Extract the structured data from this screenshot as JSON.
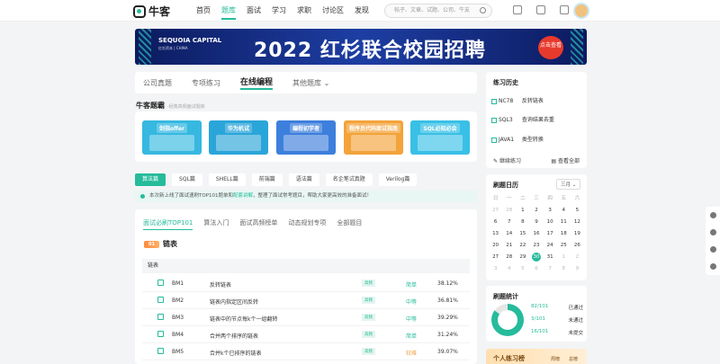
{
  "header": {
    "logo": "牛客",
    "nav": [
      "首页",
      "题库",
      "面试",
      "学习",
      "求职",
      "讨论区",
      "发现"
    ],
    "active_nav": 1,
    "search_placeholder": "帖子、文章、试题、公司、牛友"
  },
  "banner": {
    "brand": "SEQUOIA CAPITAL",
    "brand_sub": "红杉资本 | CHINA",
    "headline": "2022 红杉联合校园招聘",
    "button": "点击查看"
  },
  "tabs": [
    "公司真题",
    "专项练习",
    "在线编程",
    "其他题库"
  ],
  "section": {
    "title": "牛客题霸",
    "subtitle": "-经典高频面试题库"
  },
  "tiles": [
    {
      "label": "剑指offer",
      "color": "#36b8e0"
    },
    {
      "label": "华为机试",
      "color": "#2aa5d9"
    },
    {
      "label": "编程初学者",
      "color": "#3d7fdc"
    },
    {
      "label": "程序员代码面试指南",
      "color": "#f3a33a"
    },
    {
      "label": "SQL必知必会",
      "color": "#39c0e6"
    }
  ],
  "pills": [
    "算法篇",
    "SQL篇",
    "SHELL篇",
    "前端篇",
    "语法篇",
    "名企笔试真题",
    "Verilog篇"
  ],
  "notice": {
    "text1": "本次新上线了面试速刷TOP101题单和",
    "link": "配套讲解",
    "text2": "，整理了面试常考题目，帮助大家更高效的准备面试！"
  },
  "list": {
    "tabs": [
      "面试必刷TOP101",
      "算法入门",
      "面试高频榜单",
      "动态规划专项",
      "全部题目"
    ],
    "chapter_no": "01",
    "chapter_name": "链表",
    "group": "链表",
    "rows": [
      {
        "id": "BM1",
        "title": "反转链表",
        "tag": "高频",
        "level": "简单",
        "level_color": "#25bb9b",
        "pct": "38.12%"
      },
      {
        "id": "BM2",
        "title": "链表内指定区间反转",
        "tag": "高频",
        "level": "中等",
        "level_color": "#25bb9b",
        "pct": "36.81%"
      },
      {
        "id": "BM3",
        "title": "链表中的节点每k个一组翻转",
        "tag": "高频",
        "level": "中等",
        "level_color": "#25bb9b",
        "pct": "39.29%"
      },
      {
        "id": "BM4",
        "title": "合并两个排序的链表",
        "tag": "高频",
        "level": "简单",
        "level_color": "#25bb9b",
        "pct": "31.24%"
      },
      {
        "id": "BM5",
        "title": "合并k个已排序的链表",
        "tag": "高频",
        "level": "较难",
        "level_color": "#f0a24a",
        "pct": "39.07%"
      }
    ]
  },
  "history": {
    "title": "练习历史",
    "items": [
      {
        "no": "NC78",
        "name": "反转链表"
      },
      {
        "no": "SQL3",
        "name": "查询结果去重"
      },
      {
        "no": "JAVA1",
        "name": "类型转换"
      }
    ],
    "btn1": "继续练习",
    "btn2": "查看全部"
  },
  "calendar": {
    "title": "刷题日历",
    "month": "三月",
    "weekdays": [
      "日",
      "一",
      "二",
      "三",
      "四",
      "五",
      "六"
    ],
    "days": [
      "27",
      "28",
      "1",
      "2",
      "3",
      "4",
      "5",
      "6",
      "7",
      "8",
      "9",
      "10",
      "11",
      "12",
      "13",
      "14",
      "15",
      "16",
      "17",
      "18",
      "19",
      "20",
      "21",
      "22",
      "23",
      "24",
      "25",
      "26",
      "27",
      "28",
      "29",
      "30",
      "31",
      "1",
      "2",
      "3",
      "4",
      "5",
      "6",
      "7",
      "8",
      "9"
    ],
    "today": "30"
  },
  "stats": {
    "title": "刷题统计",
    "rows": [
      {
        "value": "82/101",
        "label": "已通过"
      },
      {
        "value": "3/101",
        "label": "未通过"
      },
      {
        "value": "16/101",
        "label": "未提交"
      }
    ],
    "passed_fraction": 0.85
  },
  "promo": {
    "title": "个人练习榜",
    "t1": "周榜",
    "t2": "总榜"
  }
}
